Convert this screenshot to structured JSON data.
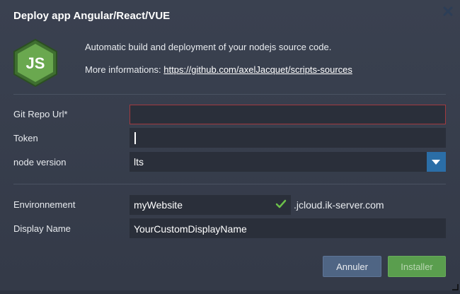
{
  "dialog": {
    "title": "Deploy app Angular/React/VUE",
    "close_icon": "close-icon"
  },
  "header": {
    "logo_text": "JS",
    "description": "Automatic build and deployment of your nodejs source code.",
    "info_prefix": "More informations: ",
    "info_link": "https://github.com/axelJacquet/scripts-sources"
  },
  "form": {
    "git_repo": {
      "label": "Git Repo Url*",
      "value": "",
      "state": "error"
    },
    "token": {
      "label": "Token",
      "value": ""
    },
    "node_version": {
      "label": "node version",
      "selected": "lts"
    },
    "environment": {
      "label": "Environnement",
      "value": "myWebsite",
      "domain": ".jcloud.ik-server.com",
      "valid": true
    },
    "display_name": {
      "label": "Display Name",
      "value": "YourCustomDisplayName"
    }
  },
  "buttons": {
    "cancel": "Annuler",
    "install": "Installer"
  },
  "colors": {
    "background": "#3a4150",
    "input_bg": "#2a2f3a",
    "error_border": "#a23a3f",
    "select_button": "#2b6ea7",
    "cancel_button": "#4f6584",
    "install_button": "#5a9e4e",
    "check": "#6cc04a"
  }
}
